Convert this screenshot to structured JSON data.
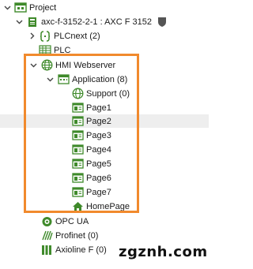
{
  "tree": {
    "project": {
      "label": "Project",
      "icon": "project-folder-icon"
    },
    "device": {
      "label": "axc-f-3152-2-1 : AXC F 3152",
      "icon": "controller-icon",
      "badge_icon": "shield-icon"
    },
    "plcnext": {
      "label": "PLCnext (2)",
      "icon": "code-braces-icon"
    },
    "plc": {
      "label": "PLC",
      "icon": "plc-grid-icon"
    },
    "hmi_webserver": {
      "label": "HMI Webserver",
      "icon": "globe-icon"
    },
    "application": {
      "label": "Application (8)",
      "icon": "application-window-icon"
    },
    "support": {
      "label": "Support (0)",
      "icon": "globe-icon"
    },
    "pages": [
      {
        "label": "Page1",
        "icon": "page-icon"
      },
      {
        "label": "Page2",
        "icon": "page-icon"
      },
      {
        "label": "Page3",
        "icon": "page-icon"
      },
      {
        "label": "Page4",
        "icon": "page-icon"
      },
      {
        "label": "Page5",
        "icon": "page-icon"
      },
      {
        "label": "Page6",
        "icon": "page-icon"
      },
      {
        "label": "Page7",
        "icon": "page-icon"
      }
    ],
    "homepage": {
      "label": "HomePage",
      "icon": "home-icon"
    },
    "opc_ua": {
      "label": "OPC UA",
      "icon": "opc-ua-icon"
    },
    "profinet": {
      "label": "Profinet (0)",
      "icon": "profinet-icon"
    },
    "axioline": {
      "label": "Axioline F (0)",
      "icon": "axioline-icon"
    },
    "selected_item": "Page2"
  },
  "watermark": {
    "text": "zgznh.com"
  },
  "colors": {
    "highlight": "#f18a2d",
    "icon_green": "#3f8a2b",
    "selected_row": "#eeeeee"
  }
}
